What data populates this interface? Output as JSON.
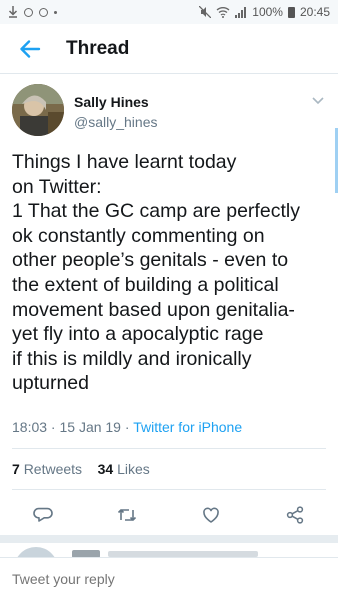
{
  "status_bar": {
    "battery": "100%",
    "time": "20:45"
  },
  "appbar": {
    "title": "Thread"
  },
  "tweet": {
    "author_name": "Sally Hines",
    "author_handle": "@sally_hines",
    "text": "Things I have learnt today\non Twitter:\n1 That the GC camp are perfectly\nok constantly commenting on\nother people’s genitals - even to\nthe extent of building a political\nmovement based upon genitalia-\nyet fly into a apocalyptic rage\nif this is mildly and ironically\nupturned",
    "timestamp": "18:03 · 15 Jan 19",
    "source": "Twitter for iPhone",
    "retweets_count": "7",
    "retweets_label": "Retweets",
    "likes_count": "34",
    "likes_label": "Likes"
  },
  "reply_bar": {
    "placeholder": "Tweet your reply"
  },
  "icons": [
    "download-icon",
    "notification-icon",
    "mute-icon",
    "wifi-icon",
    "signal-icon",
    "battery-icon",
    "back-arrow-icon",
    "chevron-down-icon",
    "reply-icon",
    "retweet-icon",
    "like-icon",
    "share-icon"
  ],
  "colors": {
    "accent": "#1da1f2",
    "text": "#14171a",
    "secondary": "#657786"
  }
}
